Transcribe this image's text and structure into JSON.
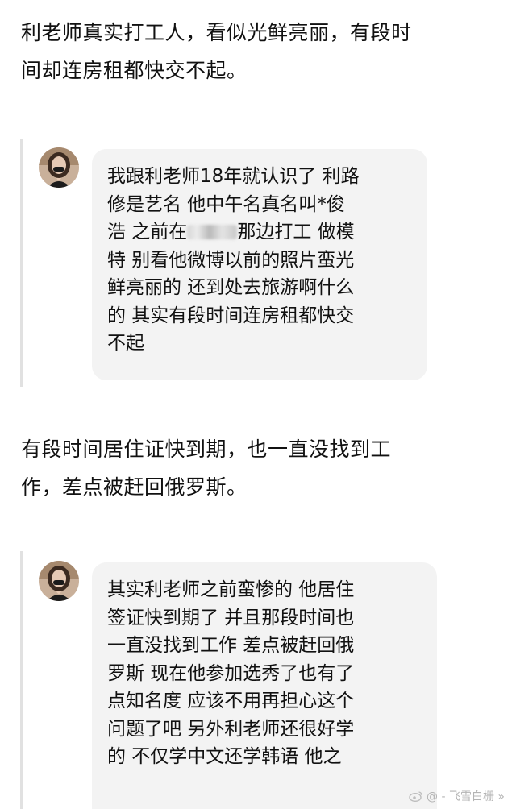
{
  "paragraph_1": [
    "利老师真实打工人，看似光鲜亮丽，有段时",
    "间却连房租都快交不起。"
  ],
  "comment_1": {
    "lines": [
      "我跟利老师18年就认识了 利路",
      "修是艺名 他中午名真名叫*俊",
      "浩 之前在",
      "那边打工 做模",
      "特 别看他微博以前的照片蛮光",
      "鲜亮丽的 还到处去旅游啊什么",
      "的 其实有段时间连房租都快交",
      "不起"
    ]
  },
  "paragraph_2": [
    "有段时间居住证快到期，也一直没找到工",
    "作，差点被赶回俄罗斯。"
  ],
  "comment_2": {
    "lines": [
      "其实利老师之前蛮惨的 他居住",
      "签证快到期了 并且那段时间也",
      "一直没找到工作 差点被赶回俄",
      "罗斯 现在他参加选秀了也有了",
      "点知名度 应该不用再担心这个",
      "问题了吧 另外利老师还很好学",
      "的 不仅学中文还学韩语 他之"
    ]
  },
  "watermark": {
    "platform_icon": "weibo-logo",
    "handle": "@ - 飞雪白栅 »"
  },
  "colors": {
    "text": "#111111",
    "bubble_bg": "#f3f3f3",
    "quote_rule": "#e1e1e1",
    "watermark": "#b4b4b4"
  }
}
